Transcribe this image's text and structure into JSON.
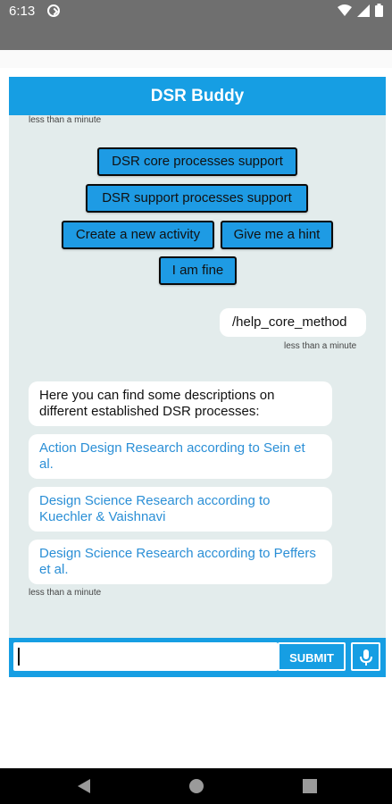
{
  "status_bar": {
    "time": "6:13"
  },
  "app": {
    "title": "DSR Buddy"
  },
  "chat": {
    "timestamps": {
      "top": "less than a minute",
      "user": "less than a minute",
      "bot": "less than a minute"
    },
    "quick_replies": [
      "DSR core processes support",
      "DSR support processes support",
      "Create a new activity",
      "Give me a hint",
      "I am fine"
    ],
    "user_message": "/help_core_method",
    "bot_message": "Here you can find some descriptions on different established DSR processes:",
    "bot_links": [
      "Action Design Research according to Sein et al.",
      "Design Science Research according to Kuechler & Vaishnavi",
      "Design Science Research according to Peffers et al."
    ]
  },
  "composer": {
    "input_value": "",
    "submit_label": "SUBMIT"
  }
}
